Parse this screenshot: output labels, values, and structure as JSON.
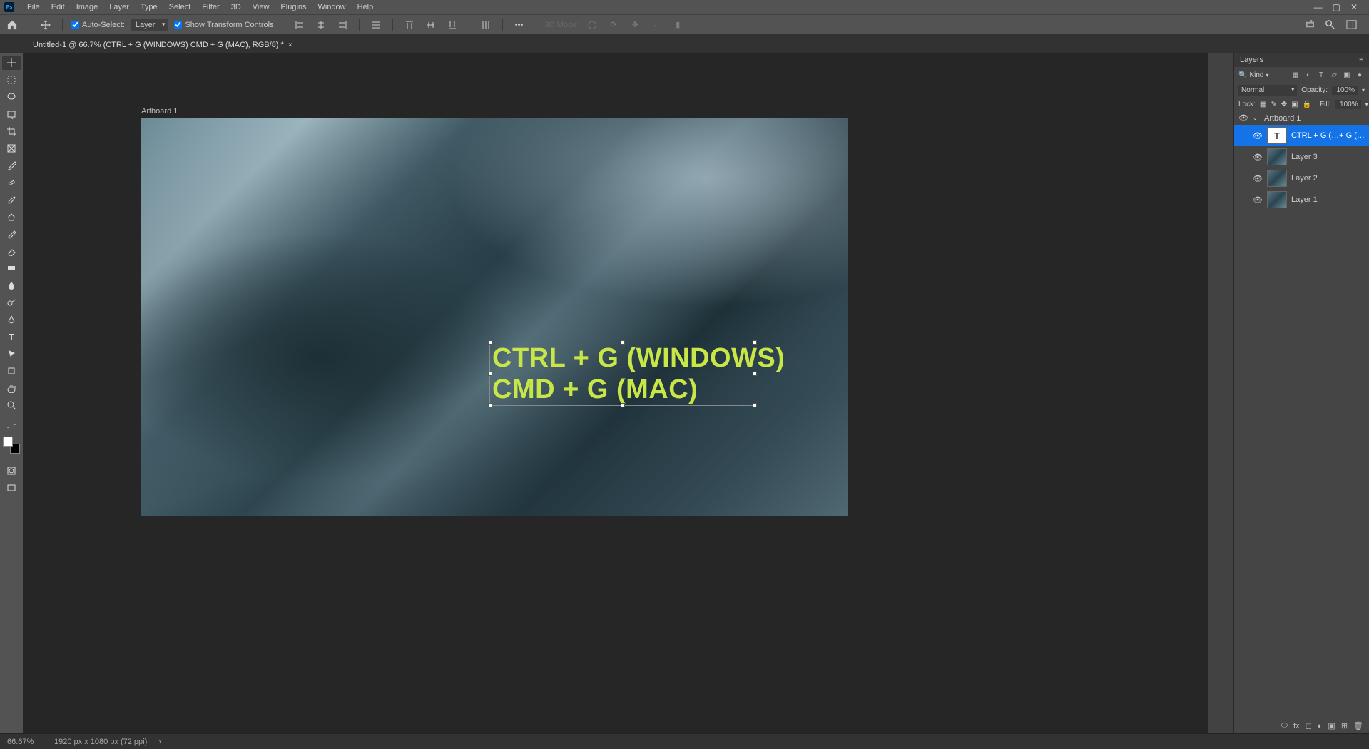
{
  "menubar": {
    "items": [
      "File",
      "Edit",
      "Image",
      "Layer",
      "Type",
      "Select",
      "Filter",
      "3D",
      "View",
      "Plugins",
      "Window",
      "Help"
    ]
  },
  "optionsbar": {
    "auto_select_label": "Auto-Select:",
    "auto_select_target": "Layer",
    "show_transform_label": "Show Transform Controls",
    "mode3d_label": "3D Mode:"
  },
  "tab": {
    "title": "Untitled-1 @ 66.7% (CTRL + G (WINDOWS) CMD + G (MAC), RGB/8) *"
  },
  "canvas": {
    "artboard_label": "Artboard 1",
    "text_line1": "CTRL + G (WINDOWS)",
    "text_line2": "CMD + G (MAC)"
  },
  "layers_panel": {
    "title": "Layers",
    "filter_label": "Kind",
    "blend_mode": "Normal",
    "opacity_label": "Opacity:",
    "opacity_value": "100%",
    "lock_label": "Lock:",
    "fill_label": "Fill:",
    "fill_value": "100%",
    "artboard_name": "Artboard 1",
    "items": [
      {
        "name": "CTRL + G (…+ G (MAC)",
        "type": "text",
        "selected": true
      },
      {
        "name": "Layer 3",
        "type": "image",
        "selected": false
      },
      {
        "name": "Layer 2",
        "type": "image",
        "selected": false
      },
      {
        "name": "Layer 1",
        "type": "image",
        "selected": false
      }
    ]
  },
  "statusbar": {
    "zoom": "66.67%",
    "doc_info": "1920 px x 1080 px (72 ppi)"
  }
}
